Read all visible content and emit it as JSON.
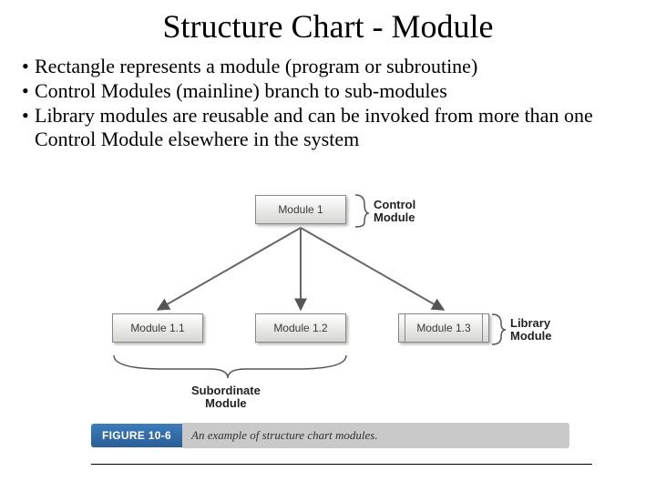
{
  "title": "Structure Chart - Module",
  "bullets": [
    "Rectangle represents a module (program or subroutine)",
    "Control Modules (mainline) branch to sub-modules",
    "Library modules are reusable and can be invoked from more than one Control Module elsewhere in the system"
  ],
  "diagram": {
    "modules": {
      "top": "Module 1",
      "m1": "Module 1.1",
      "m2": "Module 1.2",
      "m3": "Module 1.3"
    },
    "annotations": {
      "control": "Control\nModule",
      "library": "Library\nModule",
      "subordinate": "Subordinate\nModule"
    },
    "figure_tag": "FIGURE 10-6",
    "figure_caption": "An example of structure chart modules."
  }
}
